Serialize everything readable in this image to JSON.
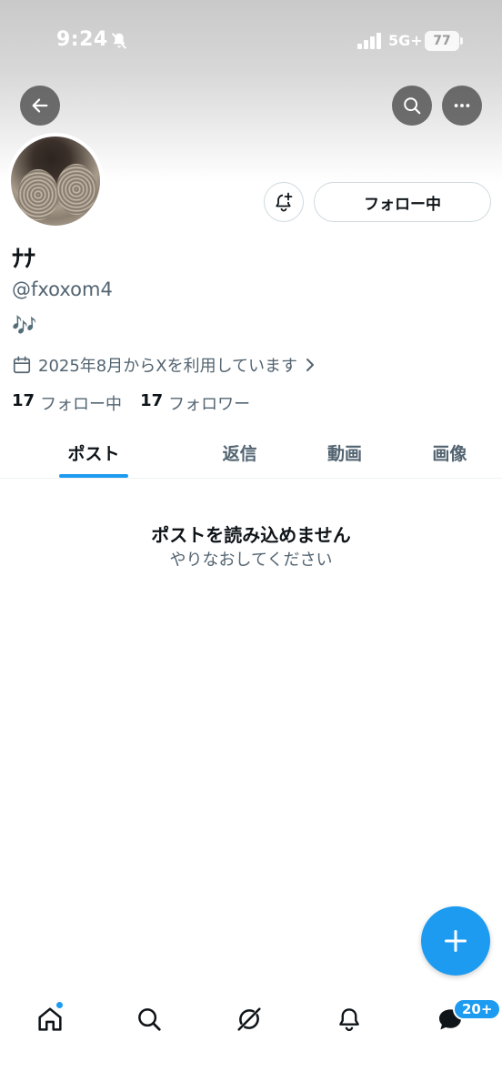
{
  "status_bar": {
    "time": "9:24",
    "network": "5G+",
    "battery": "77"
  },
  "profile": {
    "display_name": "ﾅﾅ",
    "handle": "@fxoxom4",
    "bio": "🎶",
    "joined": "2025年8月からXを利用しています",
    "following_count": "17",
    "following_label": "フォロー中",
    "followers_count": "17",
    "followers_label": "フォロワー",
    "follow_button_label": "フォロー中"
  },
  "tabs": [
    {
      "label": "ポスト",
      "active": true
    },
    {
      "label": "返信",
      "active": false
    },
    {
      "label": "動画",
      "active": false
    },
    {
      "label": "画像",
      "active": false
    }
  ],
  "error": {
    "title": "ポストを読み込めません",
    "retry": "やりなおしてください"
  },
  "bottom_nav": {
    "items": [
      "home-icon",
      "search-icon",
      "grok-icon",
      "notifications-icon",
      "messages-icon"
    ],
    "messages_badge": "20+"
  },
  "colors": {
    "accent": "#1d9bf0",
    "text_primary": "#0f1419",
    "text_secondary": "#536471"
  }
}
